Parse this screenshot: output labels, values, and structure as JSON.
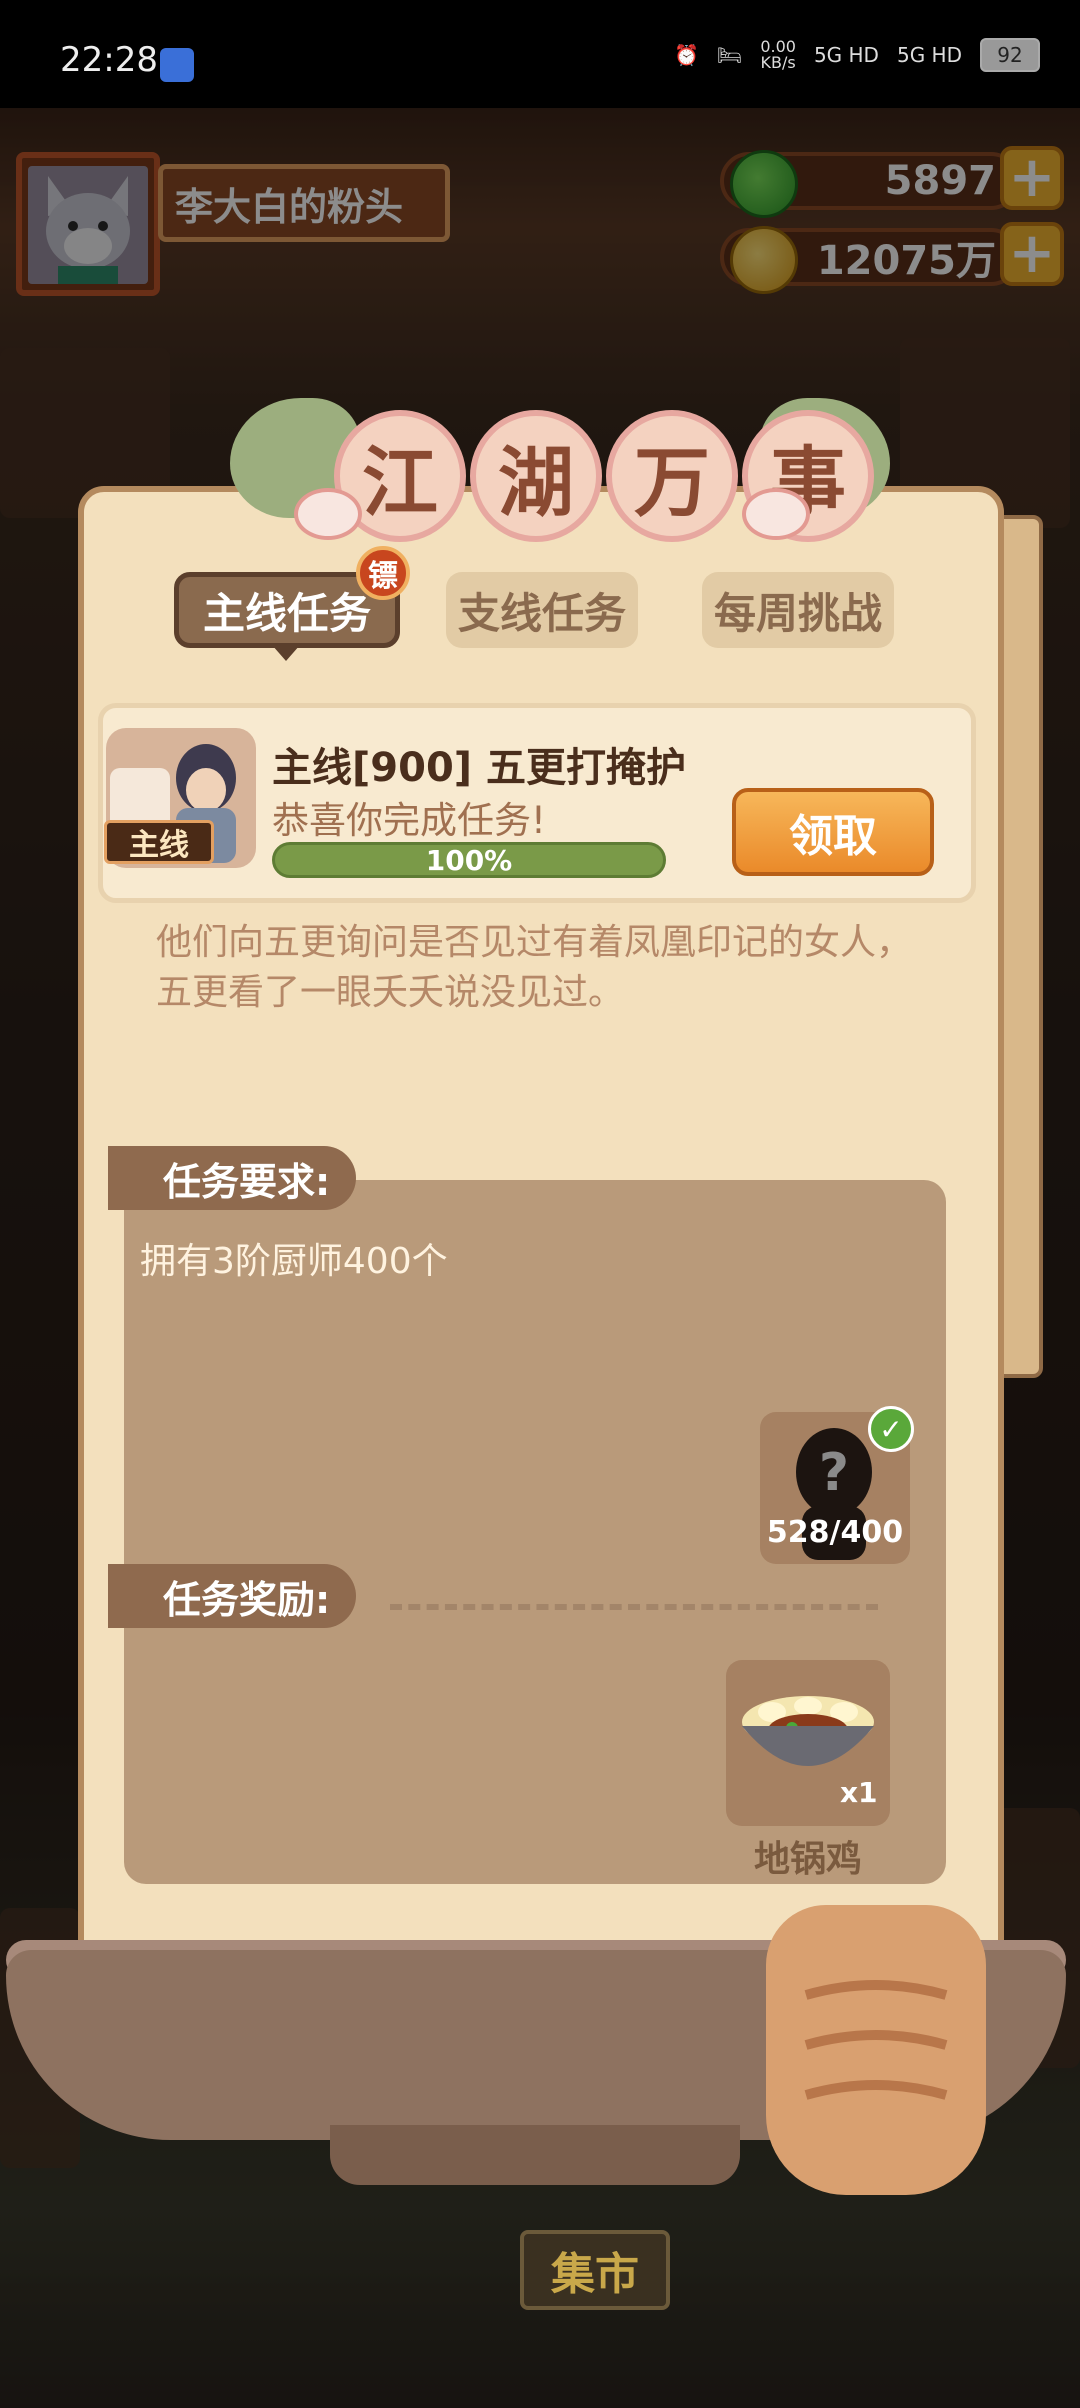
{
  "status_bar": {
    "time": "22:28",
    "net_speed": "0.00\nKB/s",
    "signal_1": "5G HD",
    "signal_2": "5G HD",
    "battery": "92"
  },
  "header": {
    "player_name": "李大白的粉头",
    "jade": "5897",
    "gold": "12075万"
  },
  "panel": {
    "title_chars": [
      "江",
      "湖",
      "万",
      "事"
    ],
    "tabs": [
      {
        "label": "主线任务",
        "active": true
      },
      {
        "label": "支线任务",
        "active": false
      },
      {
        "label": "每周挑战",
        "active": false
      }
    ],
    "tab_badge": "镖"
  },
  "quest": {
    "tag": "主线",
    "title": "主线[900] 五更打掩护",
    "subtitle": "恭喜你完成任务!",
    "progress_text": "100%",
    "progress": 1.0,
    "claim_label": "领取",
    "story": "他们向五更询问是否见过有着凤凰印记的女人，五更看了一眼夭夭说没见过。"
  },
  "requirement": {
    "label": "任务要求:",
    "text": "拥有3阶厨师400个",
    "count": "528/400"
  },
  "reward": {
    "label": "任务奖励:",
    "qty": "x1",
    "name": "地锅鸡"
  },
  "bottom": {
    "sign": "集市"
  },
  "colors": {
    "panel_bg": "#f3e0bd",
    "claim_btn": "#ea8a2a",
    "progress": "#7a9a48"
  }
}
